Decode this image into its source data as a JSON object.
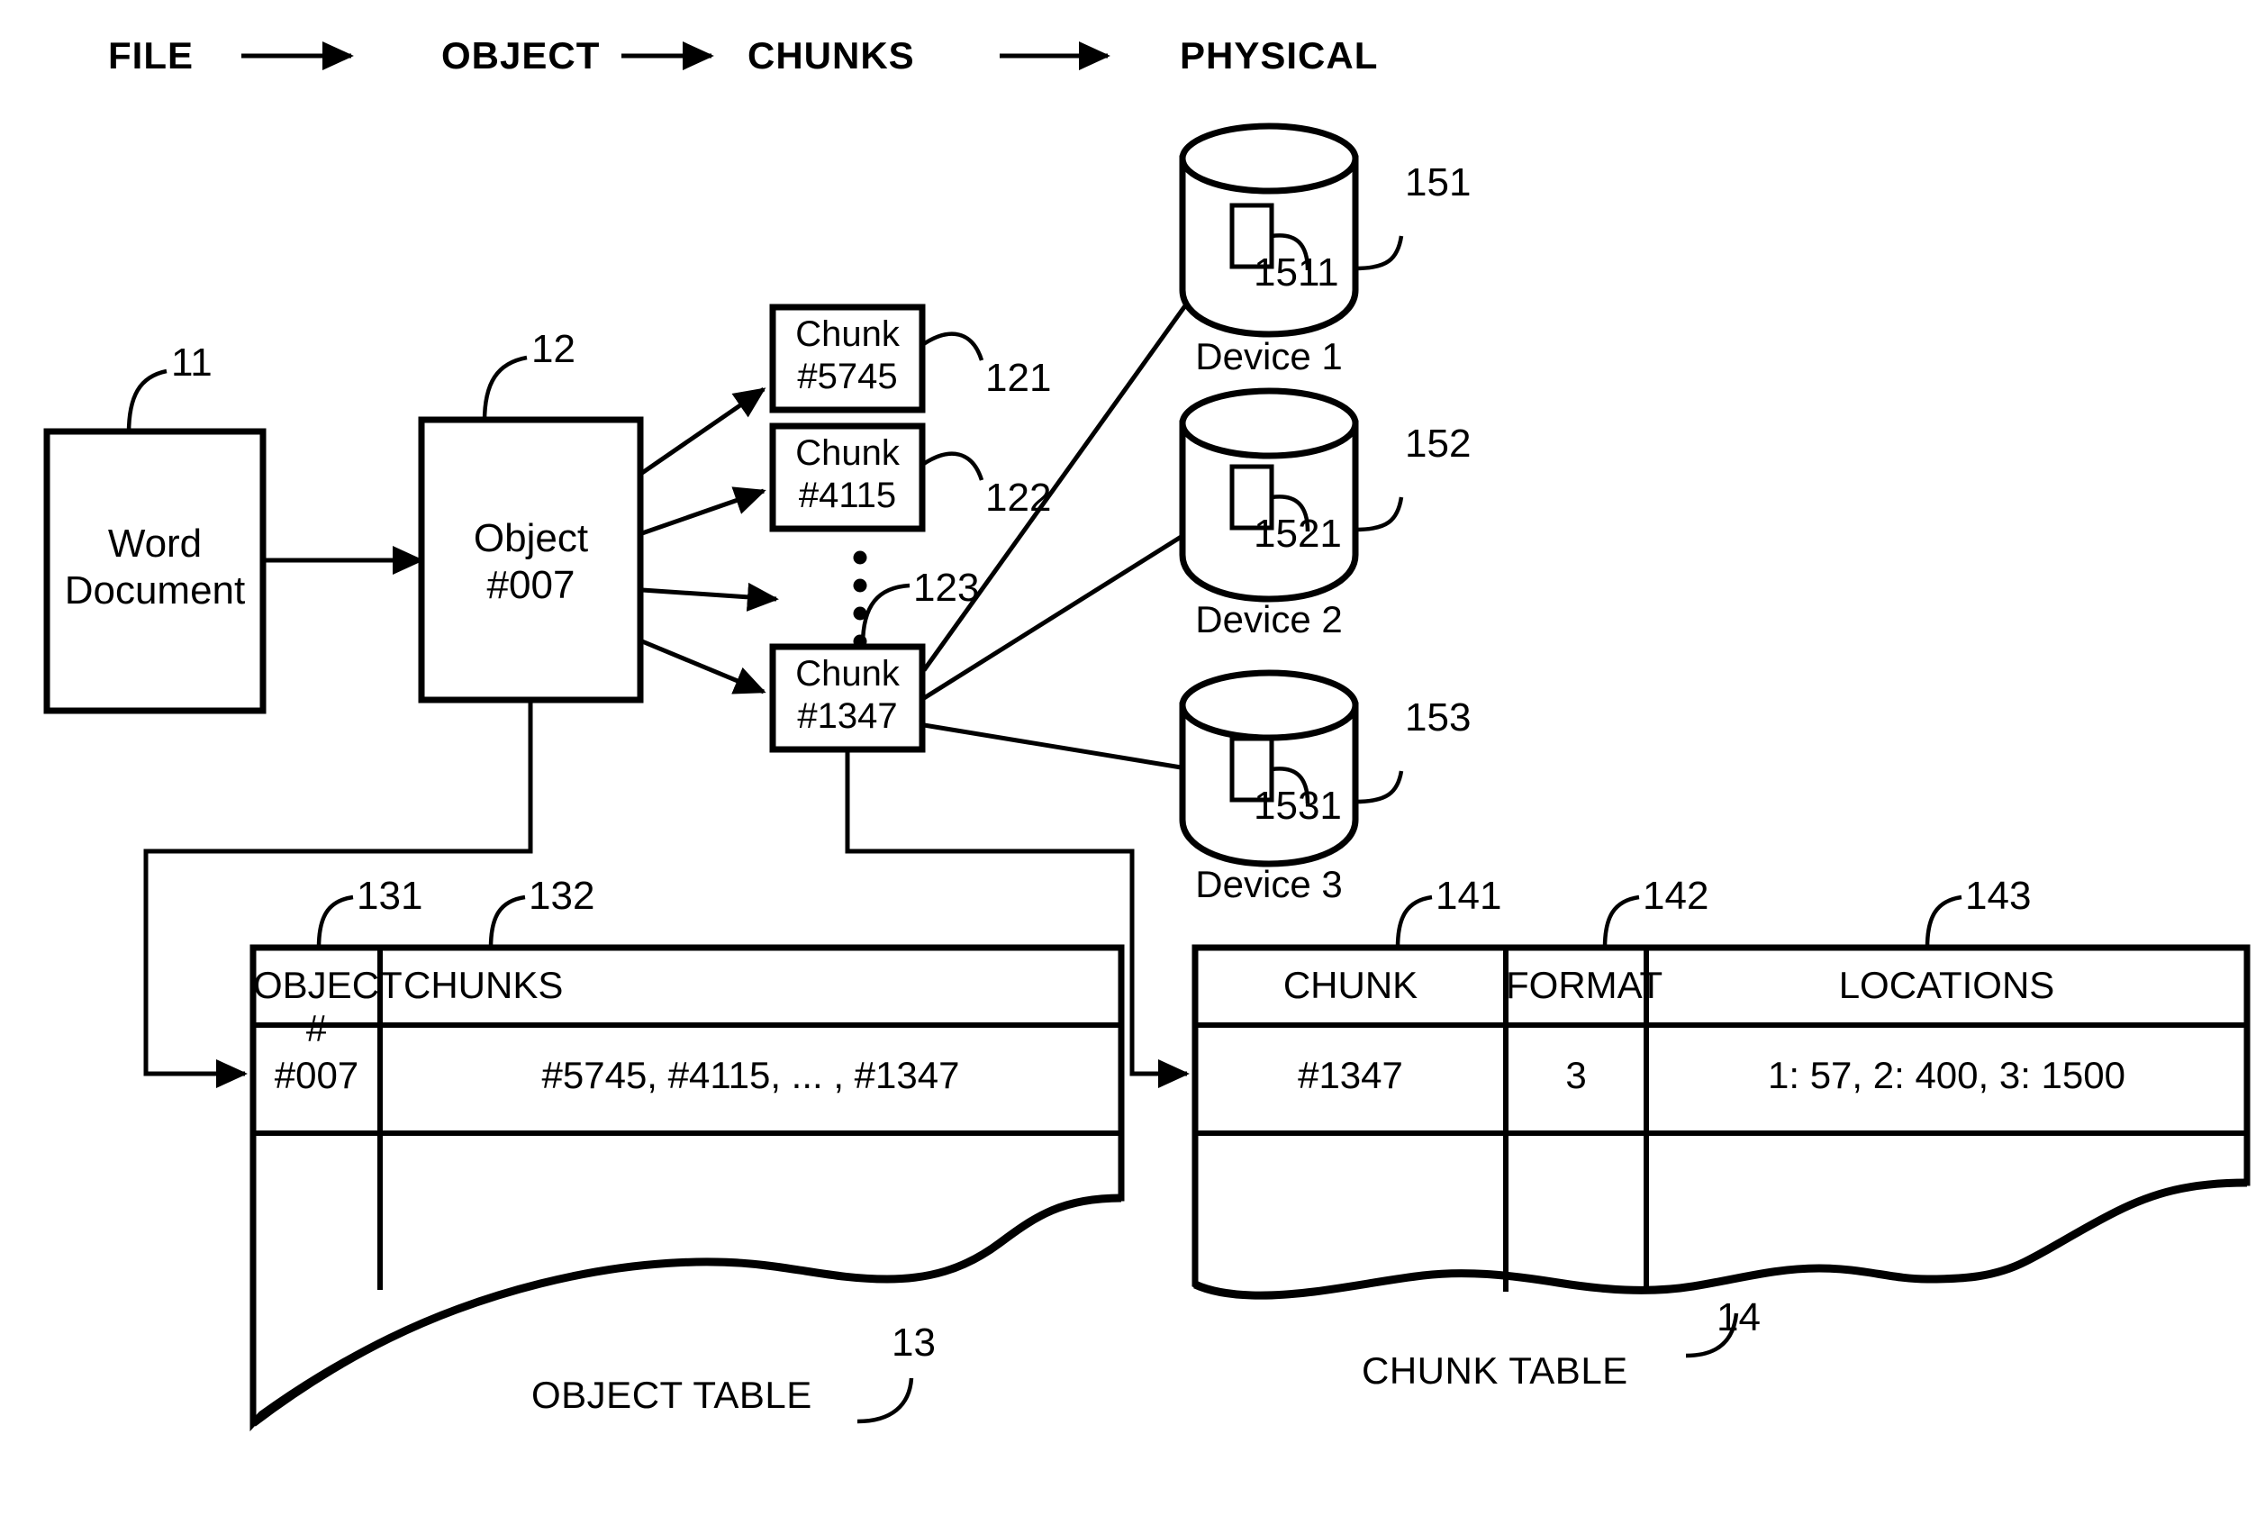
{
  "figure": {
    "flow_header": {
      "steps": [
        "FILE",
        "OBJECT",
        "CHUNKS",
        "PHYSICAL"
      ],
      "arrow_glyph": "→"
    },
    "file_box": {
      "ref": "11",
      "line1": "Word",
      "line2": "Document"
    },
    "object_box": {
      "ref": "12",
      "line1": "Object",
      "line2": "#007"
    },
    "chunks": [
      {
        "ref": "121",
        "line1": "Chunk",
        "line2": "#5745"
      },
      {
        "ref": "122",
        "line1": "Chunk",
        "line2": "#4115"
      },
      {
        "ref": "123",
        "line1": "",
        "line2": "",
        "ellipsis": "⋮"
      },
      {
        "ref": "",
        "line1": "Chunk",
        "line2": "#1347"
      }
    ],
    "devices": [
      {
        "ref": "151",
        "inner_ref": "1511",
        "label": "Device 1"
      },
      {
        "ref": "152",
        "inner_ref": "1521",
        "label": "Device 2"
      },
      {
        "ref": "153",
        "inner_ref": "1531",
        "label": "Device 3"
      }
    ],
    "object_table": {
      "ref": "13",
      "caption": "OBJECT TABLE",
      "column_refs": [
        "131",
        "132"
      ],
      "headers": [
        "OBJECT #",
        "CHUNKS"
      ],
      "rows": [
        [
          "#007",
          "#5745, #4115, ... , #1347"
        ]
      ]
    },
    "chunk_table": {
      "ref": "14",
      "caption": "CHUNK TABLE",
      "column_refs": [
        "141",
        "142",
        "143"
      ],
      "headers": [
        "CHUNK",
        "FORMAT",
        "LOCATIONS"
      ],
      "rows": [
        [
          "#1347",
          "3",
          "1: 57, 2: 400, 3: 1500"
        ]
      ]
    },
    "colors": {
      "ink": "#000000",
      "paper": "#ffffff"
    }
  }
}
